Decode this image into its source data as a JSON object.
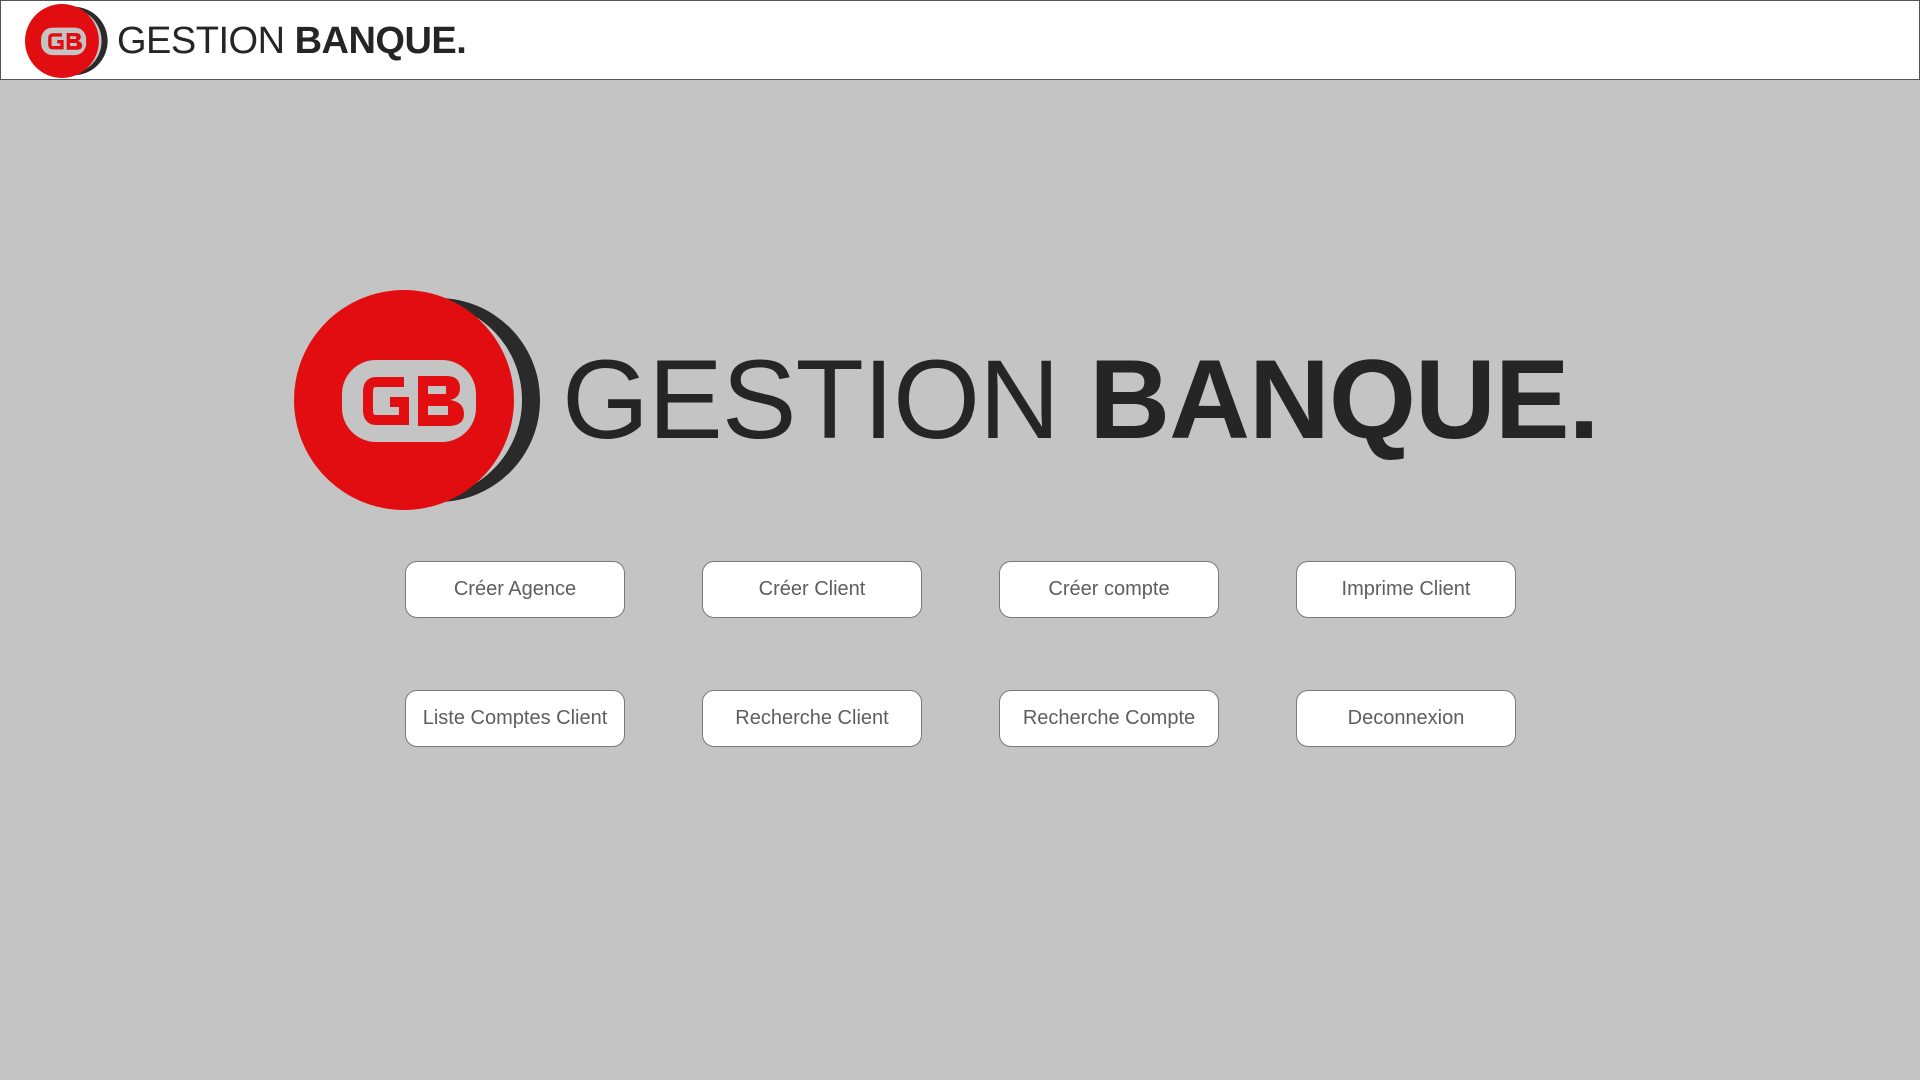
{
  "header": {
    "logo_icon": "gb-logo-icon",
    "wordmark_light": "GESTION",
    "wordmark_bold": "BANQUE."
  },
  "hero": {
    "logo_icon": "gb-logo-icon",
    "wordmark_light": "GESTION",
    "wordmark_bold": "BANQUE.",
    "logo_letters": "GB"
  },
  "colors": {
    "brand_red": "#e20d10",
    "dark": "#252525",
    "background": "#c4c4c4"
  },
  "menu": {
    "buttons": [
      {
        "label": "Créer Agence"
      },
      {
        "label": "Créer Client"
      },
      {
        "label": "Créer compte"
      },
      {
        "label": "Imprime Client"
      },
      {
        "label": "Liste Comptes Client"
      },
      {
        "label": "Recherche Client"
      },
      {
        "label": "Recherche Compte"
      },
      {
        "label": "Deconnexion"
      }
    ]
  }
}
